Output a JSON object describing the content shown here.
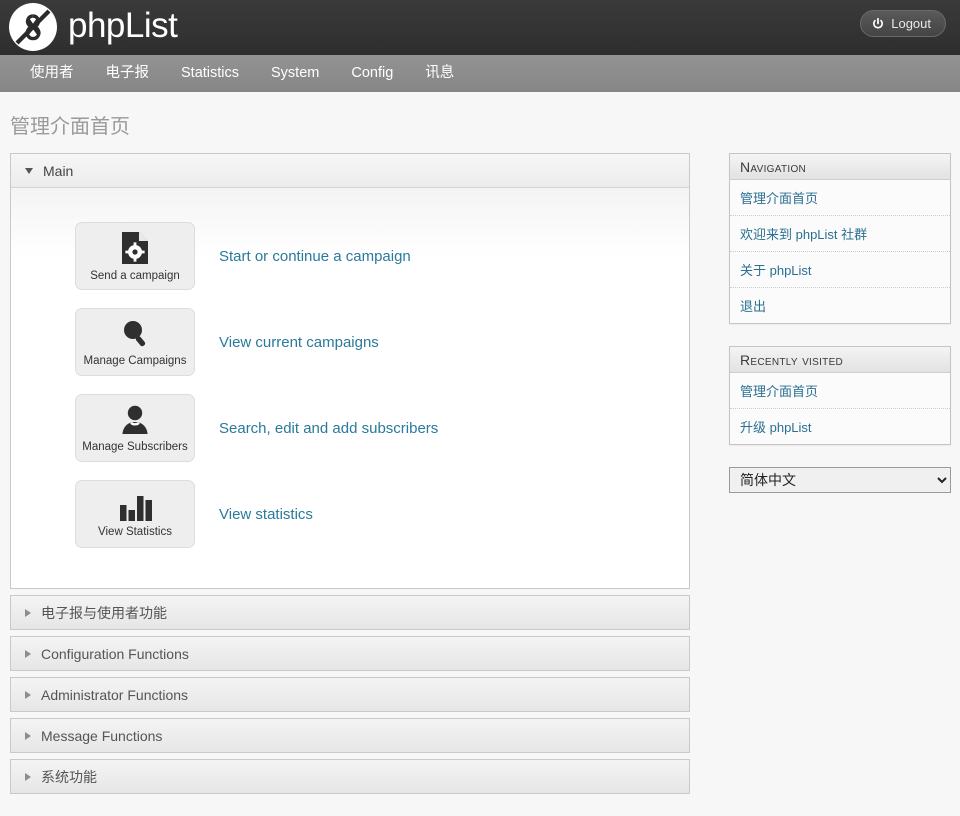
{
  "header": {
    "brand": "phpList",
    "logo_icon": "phplist-logo-icon",
    "logout_label": "Logout",
    "logout_icon": "power-icon",
    "bg_color": "#333333"
  },
  "navbar": {
    "items": [
      {
        "label": "使用者"
      },
      {
        "label": "电子报"
      },
      {
        "label": "Statistics"
      },
      {
        "label": "System"
      },
      {
        "label": "Config"
      },
      {
        "label": "讯息"
      }
    ],
    "bg_color": "#8c8c8c"
  },
  "page": {
    "title": "管理介面首页",
    "background": "#f7f7f7",
    "link_color": "#2a7a9b"
  },
  "main_panel": {
    "title": "Main",
    "expanded": true,
    "tiles": [
      {
        "label": "Send a campaign",
        "icon": "document-gear-icon",
        "link": "Start or continue a campaign"
      },
      {
        "label": "Manage Campaigns",
        "icon": "magnifier-icon",
        "link": "View current campaigns"
      },
      {
        "label": "Manage Subscribers",
        "icon": "person-icon",
        "link": "Search, edit and add subscribers"
      },
      {
        "label": "View Statistics",
        "icon": "bar-chart-icon",
        "link": "View statistics"
      }
    ]
  },
  "collapsed_sections": [
    {
      "label": "电子报与使用者功能"
    },
    {
      "label": "Configuration Functions"
    },
    {
      "label": "Administrator Functions"
    },
    {
      "label": "Message Functions"
    },
    {
      "label": "系统功能"
    }
  ],
  "sidebar": {
    "navigation": {
      "heading": "Navigation",
      "links": [
        {
          "label": "管理介面首页"
        },
        {
          "label": "欢迎来到 phpList 社群"
        },
        {
          "label": "关于 phpList"
        },
        {
          "label": "退出"
        }
      ]
    },
    "recently_visited": {
      "heading": "Recently visited",
      "links": [
        {
          "label": "管理介面首页"
        },
        {
          "label": "升级 phpList"
        }
      ]
    },
    "language": {
      "selected": "简体中文",
      "icon": "chevron-down-icon"
    }
  }
}
